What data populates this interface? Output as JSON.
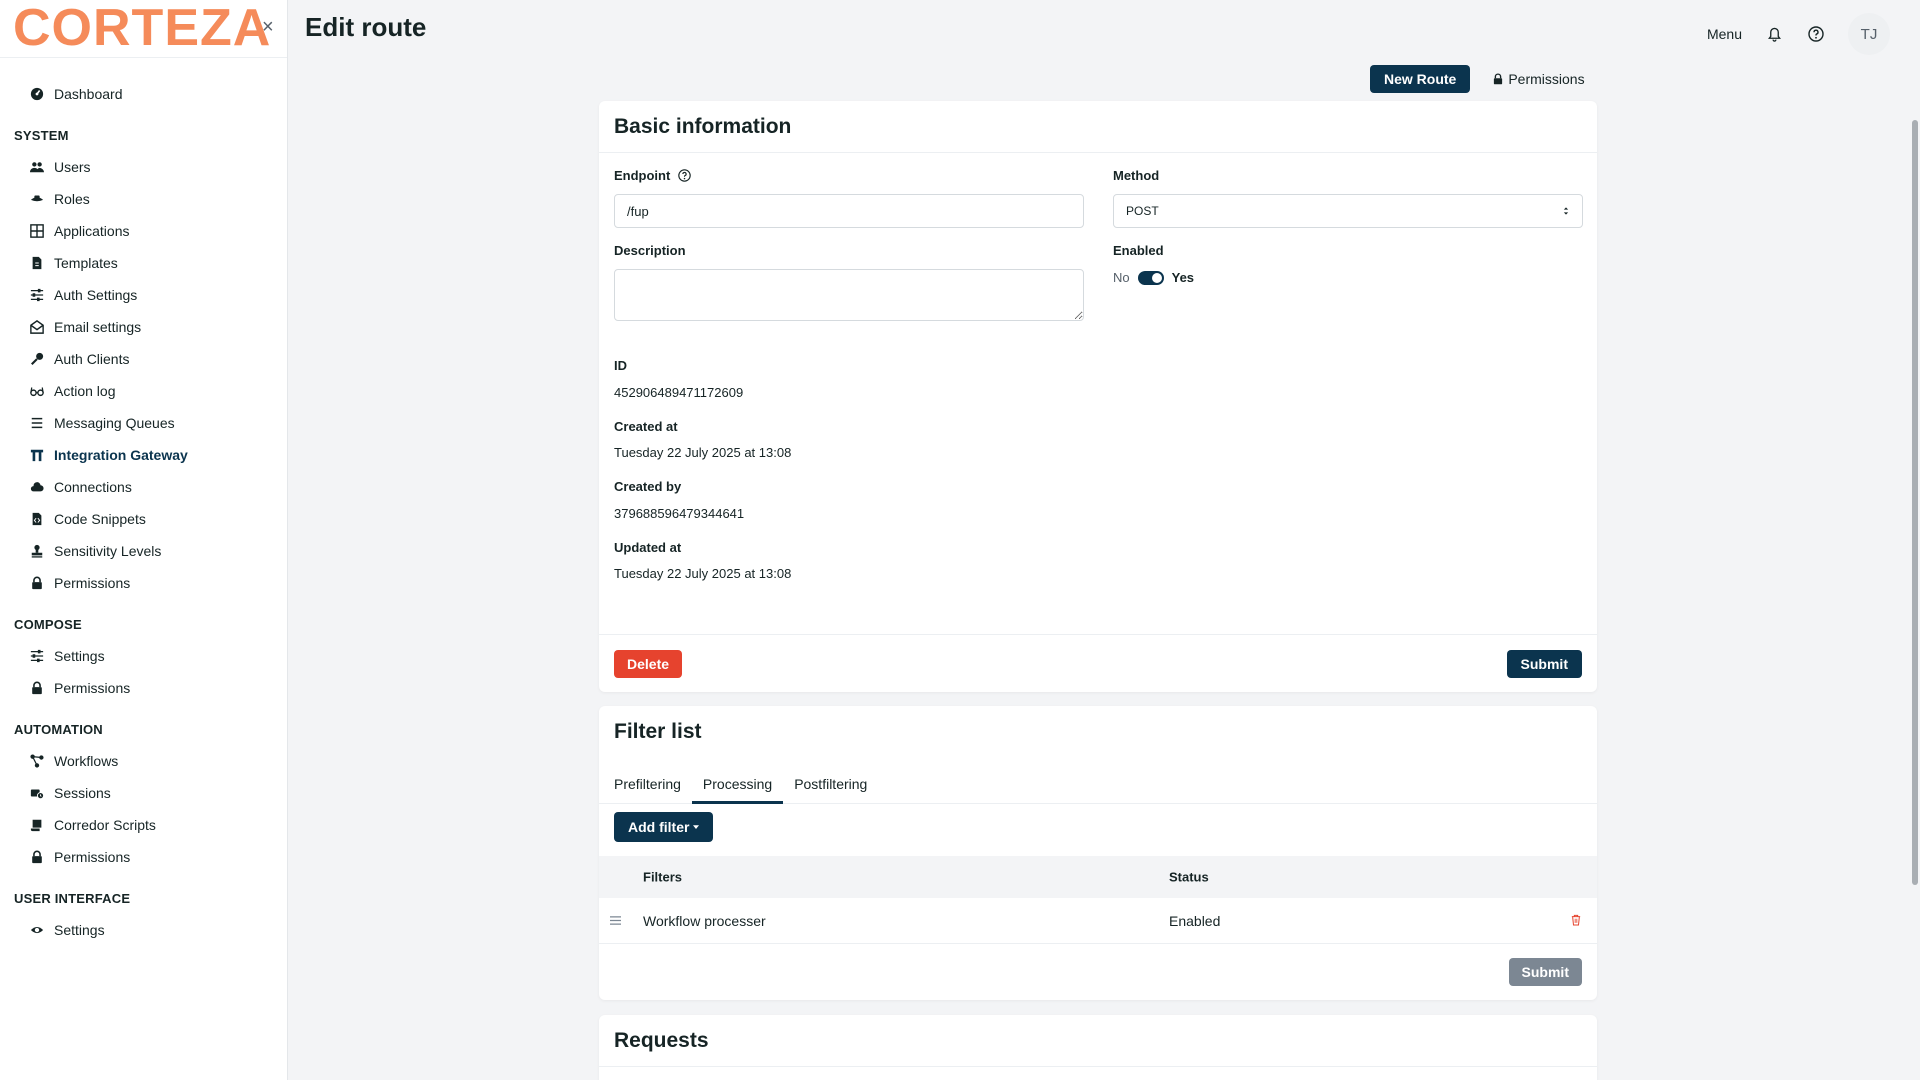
{
  "sidebar": {
    "logo": "CORTEZA",
    "close": "×",
    "dashboard": "Dashboard",
    "sections": [
      {
        "title": "SYSTEM",
        "items": [
          {
            "label": "Users",
            "icon": "users-icon"
          },
          {
            "label": "Roles",
            "icon": "roles-icon"
          },
          {
            "label": "Applications",
            "icon": "applications-icon"
          },
          {
            "label": "Templates",
            "icon": "templates-icon"
          },
          {
            "label": "Auth Settings",
            "icon": "sliders-icon"
          },
          {
            "label": "Email settings",
            "icon": "email-icon"
          },
          {
            "label": "Auth Clients",
            "icon": "key-icon"
          },
          {
            "label": "Action log",
            "icon": "glasses-icon"
          },
          {
            "label": "Messaging Queues",
            "icon": "list-icon"
          },
          {
            "label": "Integration Gateway",
            "icon": "gateway-icon",
            "active": true
          },
          {
            "label": "Connections",
            "icon": "cloud-icon"
          },
          {
            "label": "Code Snippets",
            "icon": "file-code-icon"
          },
          {
            "label": "Sensitivity Levels",
            "icon": "stamp-icon"
          },
          {
            "label": "Permissions",
            "icon": "lock-icon"
          }
        ]
      },
      {
        "title": "COMPOSE",
        "items": [
          {
            "label": "Settings",
            "icon": "sliders-icon"
          },
          {
            "label": "Permissions",
            "icon": "lock-icon"
          }
        ]
      },
      {
        "title": "AUTOMATION",
        "items": [
          {
            "label": "Workflows",
            "icon": "workflow-icon"
          },
          {
            "label": "Sessions",
            "icon": "sessions-icon"
          },
          {
            "label": "Corredor Scripts",
            "icon": "scroll-icon"
          },
          {
            "label": "Permissions",
            "icon": "lock-icon"
          }
        ]
      },
      {
        "title": "USER INTERFACE",
        "items": [
          {
            "label": "Settings",
            "icon": "eye-icon"
          }
        ]
      }
    ]
  },
  "header": {
    "title": "Edit route",
    "menu": "Menu",
    "avatar": "TJ"
  },
  "actions": {
    "new_route": "New Route",
    "permissions": "Permissions"
  },
  "basic": {
    "title": "Basic information",
    "endpoint_label": "Endpoint",
    "endpoint_value": "/fup",
    "method_label": "Method",
    "method_value": "POST",
    "description_label": "Description",
    "description_value": "",
    "enabled_label": "Enabled",
    "enabled_no": "No",
    "enabled_yes": "Yes",
    "enabled": true,
    "id_label": "ID",
    "id_value": "452906489471172609",
    "created_at_label": "Created at",
    "created_at_value": "Tuesday 22 July 2025 at 13:08",
    "created_by_label": "Created by",
    "created_by_value": "379688596479344641",
    "updated_at_label": "Updated at",
    "updated_at_value": "Tuesday 22 July 2025 at 13:08",
    "delete": "Delete",
    "submit": "Submit"
  },
  "filters": {
    "title": "Filter list",
    "tabs": [
      "Prefiltering",
      "Processing",
      "Postfiltering"
    ],
    "active_tab": "Processing",
    "add_filter": "Add filter",
    "col_filters": "Filters",
    "col_status": "Status",
    "rows": [
      {
        "name": "Workflow processer",
        "status": "Enabled"
      }
    ],
    "submit": "Submit"
  },
  "requests": {
    "title": "Requests"
  },
  "colors": {
    "primary": "#0b344e",
    "danger": "#e6432e",
    "logo": "#f58b5a"
  }
}
